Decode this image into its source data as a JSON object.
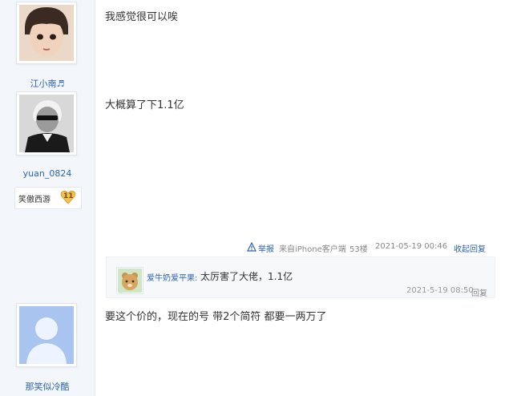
{
  "posts": [
    {
      "author": "",
      "text": "我感觉很可以唉"
    },
    {
      "author": "江小南♬",
      "text": "大概算了下1.1亿"
    },
    {
      "author": "yuan_0824",
      "badge": {
        "label": "笑傲西游",
        "level": "11"
      }
    },
    {
      "author": "那笑似冷酷",
      "text": "要这个价的，现在的号 带2个简符 都要一两万了"
    }
  ],
  "meta": {
    "report_label": "举报",
    "source": "来自iPhone客户端",
    "floor": "53楼",
    "time": "2021-05-19 00:46",
    "collapse_label": "收起回复"
  },
  "reply": {
    "username": "爱牛奶爱平果:",
    "text": "太厉害了大佬，1.1亿",
    "time": "2021-5-19 08:50",
    "reply_label": "回复"
  },
  "colors": {
    "link": "#2d64b3",
    "sidebar": "#f3f6fb",
    "badge": "#f2c24f"
  },
  "icons": {
    "report": "warning-triangle-icon",
    "badge": "heart-badge-icon"
  }
}
